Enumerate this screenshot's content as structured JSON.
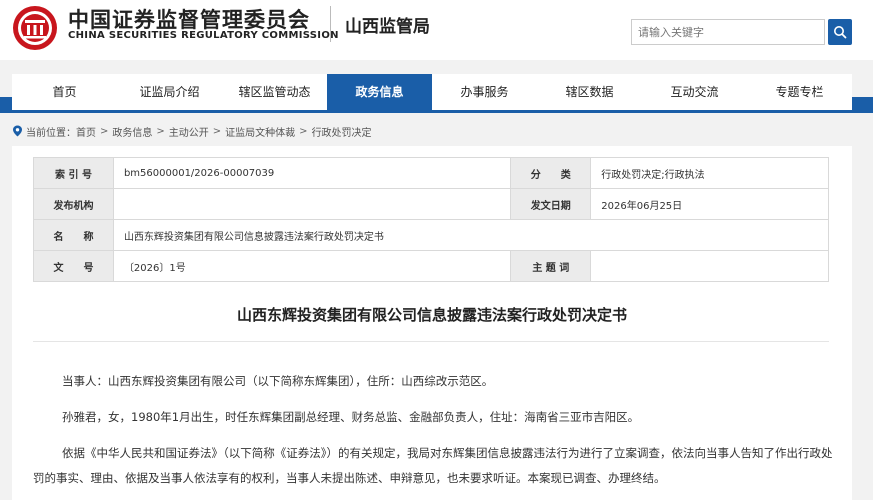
{
  "header": {
    "org_name_cn": "中国证券监督管理委员会",
    "org_name_en": "CHINA SECURITIES REGULATORY COMMISSION",
    "bureau_name": "山西监管局",
    "search_placeholder": "请输入关键字"
  },
  "nav": {
    "items": [
      {
        "label": "首页"
      },
      {
        "label": "证监局介绍"
      },
      {
        "label": "辖区监管动态"
      },
      {
        "label": "政务信息",
        "active": true
      },
      {
        "label": "办事服务"
      },
      {
        "label": "辖区数据"
      },
      {
        "label": "互动交流"
      },
      {
        "label": "专题专栏"
      }
    ]
  },
  "breadcrumb": {
    "prefix": "当前位置：",
    "items": [
      "首页",
      "政务信息",
      "主动公开",
      "证监局文种体裁",
      "行政处罚决定"
    ]
  },
  "meta": {
    "index_label": "索 引 号",
    "index_value": "bm56000001/2026-00007039",
    "category_label": "分　　类",
    "category_value": "行政处罚决定;行政执法",
    "publisher_label": "发布机构",
    "publisher_value": "",
    "date_label": "发文日期",
    "date_value": "2026年06月25日",
    "name_label": "名　　称",
    "name_value": "山西东辉投资集团有限公司信息披露违法案行政处罚决定书",
    "docno_label": "文　　号",
    "docno_value": "〔2026〕1号",
    "subject_label": "主 题 词",
    "subject_value": ""
  },
  "document": {
    "title": "山西东辉投资集团有限公司信息披露违法案行政处罚决定书",
    "paragraphs": [
      "当事人：山西东辉投资集团有限公司（以下简称东辉集团），住所：山西综改示范区。",
      "孙雅君，女，1980年1月出生，时任东辉集团副总经理、财务总监、金融部负责人，住址：海南省三亚市吉阳区。",
      "依据《中华人民共和国证券法》（以下简称《证券法》）的有关规定，我局对东辉集团信息披露违法行为进行了立案调查，依法向当事人告知了作出行政处",
      "罚的事实、理由、依据及当事人依法享有的权利，当事人未提出陈述、申辩意见，也未要求听证。本案现已调查、办理终结。"
    ]
  },
  "colors": {
    "brand_blue": "#1a5ea8",
    "emblem_red": "#c8161d"
  }
}
